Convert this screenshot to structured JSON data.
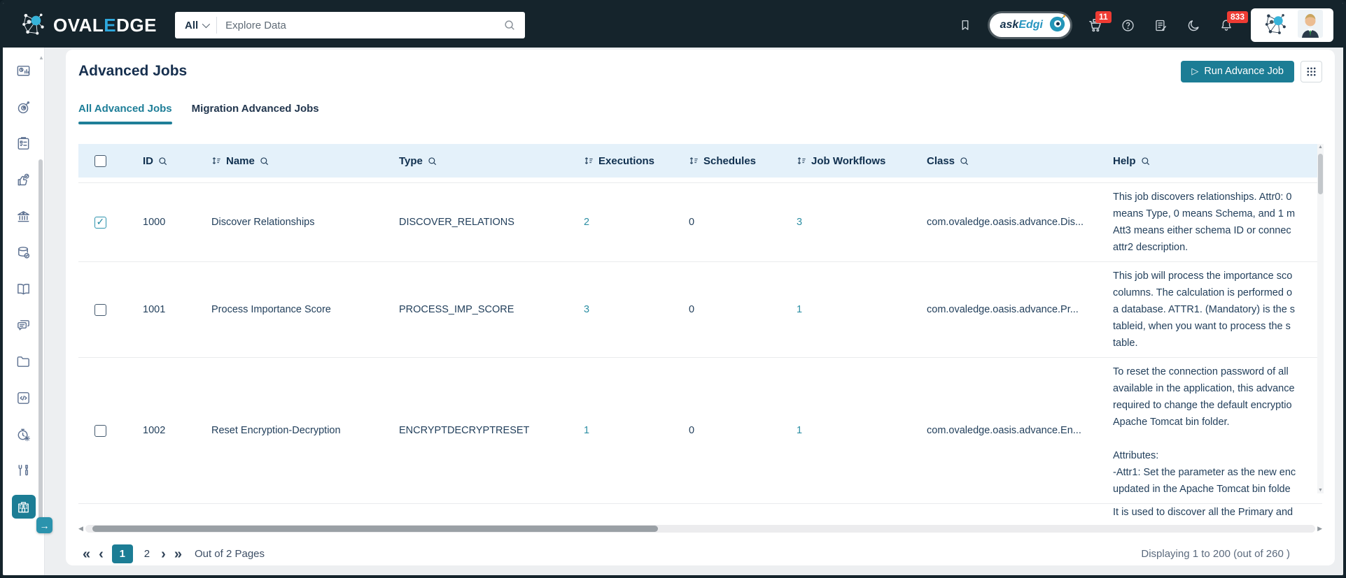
{
  "brand": {
    "name_prefix": "OVAL",
    "name_accent": "E",
    "name_suffix": "DGE"
  },
  "search": {
    "scope": "All",
    "placeholder": "Explore Data"
  },
  "topbar": {
    "ask_prefix": "ask",
    "ask_suffix": "Edgi",
    "cart_badge": "11",
    "bell_badge": "833"
  },
  "sidebar": {
    "icons": [
      "report-dashboard",
      "ai-robot",
      "projects-clipboard",
      "approval-hand",
      "governance-bank",
      "data-quality-database",
      "glossary-book",
      "collaboration-chat",
      "files-folder",
      "query-code",
      "job-scheduler",
      "tools",
      "advanced-tools-building"
    ]
  },
  "page": {
    "title": "Advanced Jobs",
    "run_button_label": "Run Advance Job",
    "tabs": [
      {
        "label": "All Advanced Jobs"
      },
      {
        "label": "Migration Advanced Jobs"
      }
    ]
  },
  "table": {
    "columns": [
      "ID",
      "Name",
      "Type",
      "Executions",
      "Schedules",
      "Job Workflows",
      "Class",
      "Help"
    ],
    "rows": [
      {
        "checked": true,
        "id": "1000",
        "name": "Discover Relationships",
        "type": "DISCOVER_RELATIONS",
        "executions": "2",
        "schedules": "0",
        "job_workflows": "3",
        "class_name": "com.ovaledge.oasis.advance.Dis...",
        "help": [
          "This job discovers relationships. Attr0: 0",
          "means Type, 0 means Schema, and 1 m",
          "Att3 means either schema ID or connec",
          "attr2 description."
        ]
      },
      {
        "checked": false,
        "id": "1001",
        "name": "Process Importance Score",
        "type": "PROCESS_IMP_SCORE",
        "executions": "3",
        "schedules": "0",
        "job_workflows": "1",
        "class_name": "com.ovaledge.oasis.advance.Pr...",
        "help": [
          "This job will process the importance sco",
          "columns. The calculation is performed o",
          "a database. ATTR1. (Mandatory) is the s",
          "tableid, when you want to process the s",
          "table."
        ]
      },
      {
        "checked": false,
        "id": "1002",
        "name": "Reset Encryption-Decryption",
        "type": "ENCRYPTDECRYPTRESET",
        "executions": "1",
        "schedules": "0",
        "job_workflows": "1",
        "class_name": "com.ovaledge.oasis.advance.En...",
        "help": [
          "To reset the connection password of all",
          "available in the application, this advance",
          "required to change the default encryptio",
          "Apache Tomcat bin folder.",
          "",
          "Attributes:",
          "-Attr1: Set the parameter as the new enc",
          "updated in the Apache Tomcat bin folde"
        ]
      },
      {
        "checked": false,
        "id": "",
        "name": "",
        "type": "",
        "executions": "",
        "schedules": "",
        "job_workflows": "",
        "class_name": "",
        "help": [
          "It is used to discover all the Primary and"
        ]
      }
    ]
  },
  "pagination": {
    "first": "«",
    "prev": "‹",
    "page1": "1",
    "page2": "2",
    "next": "›",
    "last": "»",
    "label": "Out of 2 Pages",
    "summary": "Displaying 1 to 200  (out of 260 )"
  },
  "colors": {
    "accent_teal": "#1c7d95",
    "header_navy": "#15242c",
    "badge_red": "#ee3b33",
    "link_teal": "#2d8fa4",
    "table_header_bg": "#e4f1fa"
  }
}
